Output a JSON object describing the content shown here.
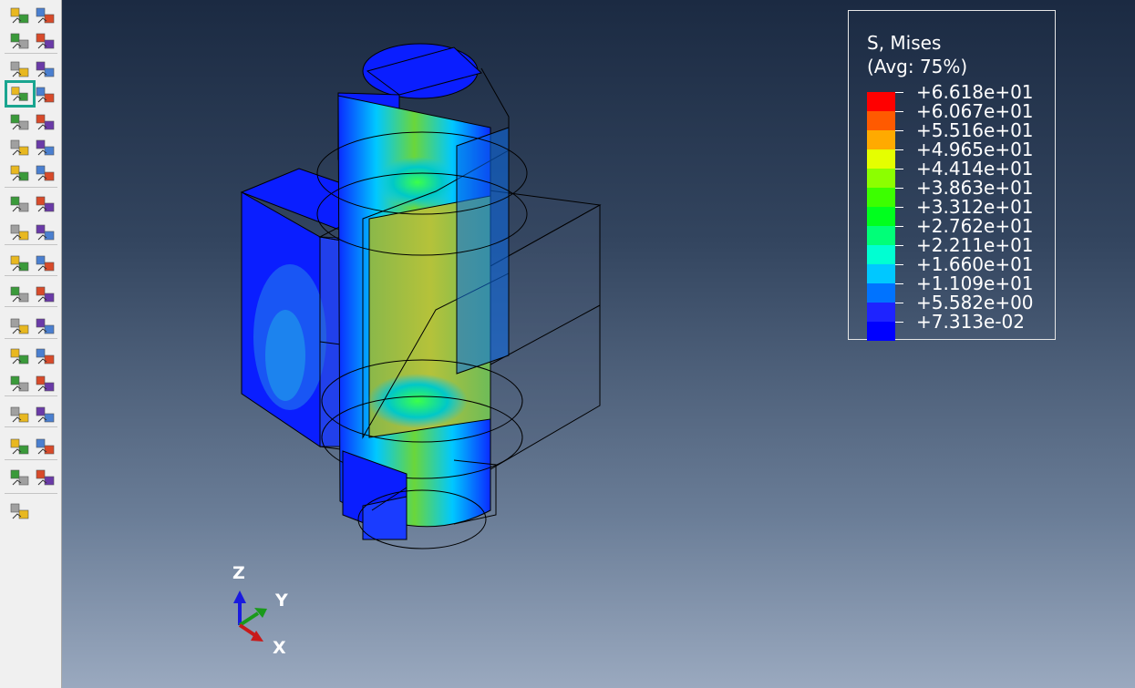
{
  "toolbox": {
    "buttons": [
      {
        "name": "element-label-icon",
        "active": false
      },
      {
        "name": "node-label-icon",
        "active": false
      },
      {
        "name": "common-options-icon",
        "active": false
      },
      {
        "name": "layers-icon",
        "active": false
      },
      {
        "name": "plot-undeformed-shape-icon",
        "active": false
      },
      {
        "name": "plot-deformed-shape-icon",
        "active": false
      },
      {
        "name": "plot-contours-on-deformed-shape-icon",
        "active": true
      },
      {
        "name": "contour-options-icon",
        "active": false
      },
      {
        "name": "plot-contours-undeformed-icon",
        "active": false
      },
      {
        "name": "contour-both-icon",
        "active": false
      },
      {
        "name": "plot-symbols-icon",
        "active": false
      },
      {
        "name": "symbol-options-icon",
        "active": false
      },
      {
        "name": "allow-multiple-plot-states-icon",
        "active": false
      },
      {
        "name": "superimpose-options-icon",
        "active": false
      },
      {
        "name": "animate-scale-factor-icon",
        "active": false
      },
      {
        "name": "animate-time-history-icon",
        "active": false
      },
      {
        "name": "animate-harmonic-icon",
        "active": false
      },
      {
        "name": "animation-options-icon",
        "active": false
      },
      {
        "name": "query-nodes-icon",
        "active": false
      },
      {
        "name": "report-field-output-icon",
        "active": false
      },
      {
        "name": "create-xy-data-icon",
        "active": false
      },
      {
        "name": "xy-data-manager-icon",
        "active": false
      },
      {
        "name": "create-path-icon",
        "active": false
      },
      {
        "name": "plot-xy-data-icon",
        "active": false
      },
      {
        "name": "view-cut-icon",
        "active": false
      },
      {
        "name": "view-cut-manager-icon",
        "active": false
      },
      {
        "name": "display-group-icon",
        "active": false
      },
      {
        "name": "display-group-manager-icon",
        "active": false
      },
      {
        "name": "free-body-cut-icon",
        "active": false
      },
      {
        "name": "free-body-manager-icon",
        "active": false
      },
      {
        "name": "stream-plot-icon",
        "active": false
      },
      {
        "name": "stream-manager-icon",
        "active": false
      },
      {
        "name": "result-combine-icon",
        "active": false
      },
      {
        "name": "combine-manager-icon",
        "active": false
      },
      {
        "name": "tools-paint-icon",
        "active": false
      }
    ]
  },
  "legend": {
    "title": "S, Mises",
    "subtitle": "(Avg: 75%)",
    "values": [
      "+6.618e+01",
      "+6.067e+01",
      "+5.516e+01",
      "+4.965e+01",
      "+4.414e+01",
      "+3.863e+01",
      "+3.312e+01",
      "+2.762e+01",
      "+2.211e+01",
      "+1.660e+01",
      "+1.109e+01",
      "+5.582e+00",
      "+7.313e-02"
    ],
    "colors": [
      "#ff0000",
      "#ff5a00",
      "#ffaa00",
      "#e5ff00",
      "#8cff00",
      "#3cff00",
      "#00ff1e",
      "#00ff78",
      "#00ffd2",
      "#00c8ff",
      "#0073ff",
      "#1e23ff",
      "#0000ff"
    ]
  },
  "triad": {
    "z": "Z",
    "y": "Y",
    "x": "X"
  }
}
